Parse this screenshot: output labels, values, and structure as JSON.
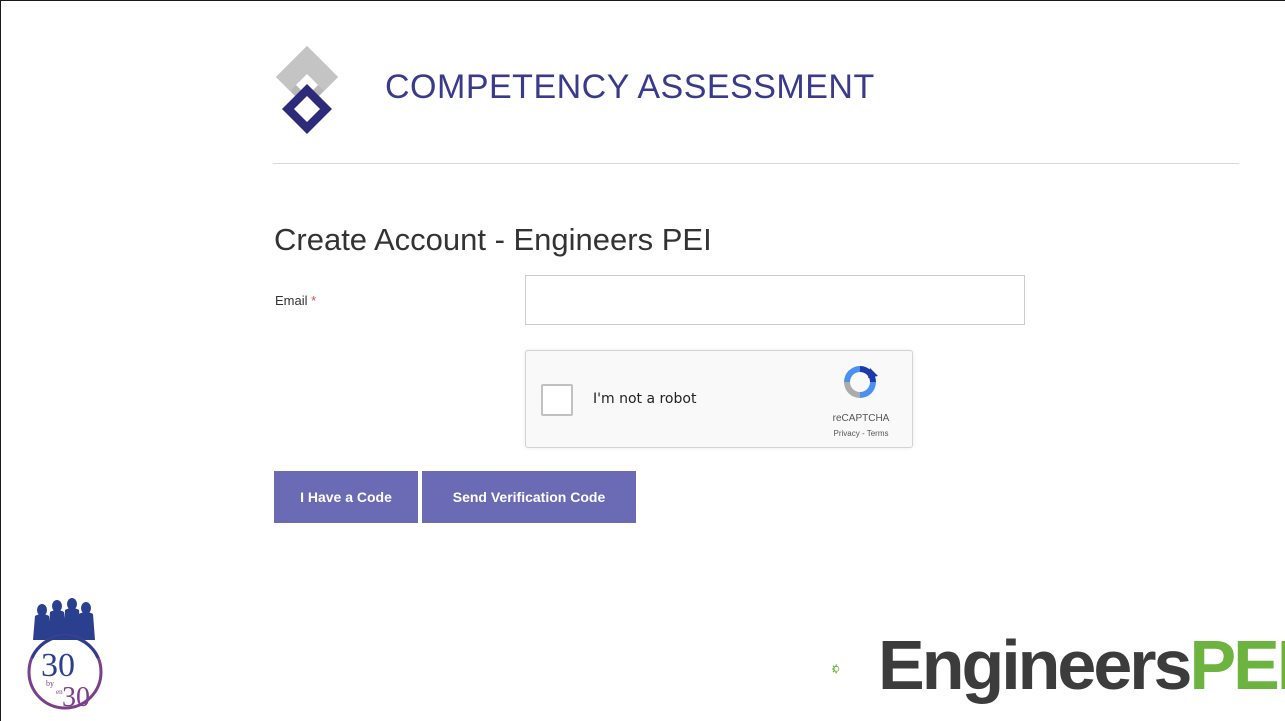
{
  "header": {
    "app_title": "COMPETENCY ASSESSMENT"
  },
  "form": {
    "page_title": "Create Account - Engineers PEI",
    "email_label": "Email",
    "required_marker": "*",
    "email_value": "",
    "email_placeholder": ""
  },
  "recaptcha": {
    "checkbox_label": "I'm not a robot",
    "brand": "reCAPTCHA",
    "links": "Privacy - Terms"
  },
  "buttons": {
    "have_code": "I Have a Code",
    "send_code": "Send Verification Code"
  },
  "footer": {
    "left_logo_text_top": "30",
    "left_logo_text_by": "by",
    "left_logo_text_en": "en",
    "left_logo_text_bottom": "30",
    "right_logo_part1": "Engineers",
    "right_logo_part2": "PEI"
  },
  "colors": {
    "brand_navy": "#2e2a7a",
    "brand_gray": "#b9b9b9",
    "title_color": "#3a3a8c",
    "button_purple": "#6b6ab5",
    "epei_green": "#6db33f",
    "epei_dark": "#3c3c3c",
    "thirty_purple": "#7b3f8c",
    "thirty_blue": "#2b3f8f"
  }
}
